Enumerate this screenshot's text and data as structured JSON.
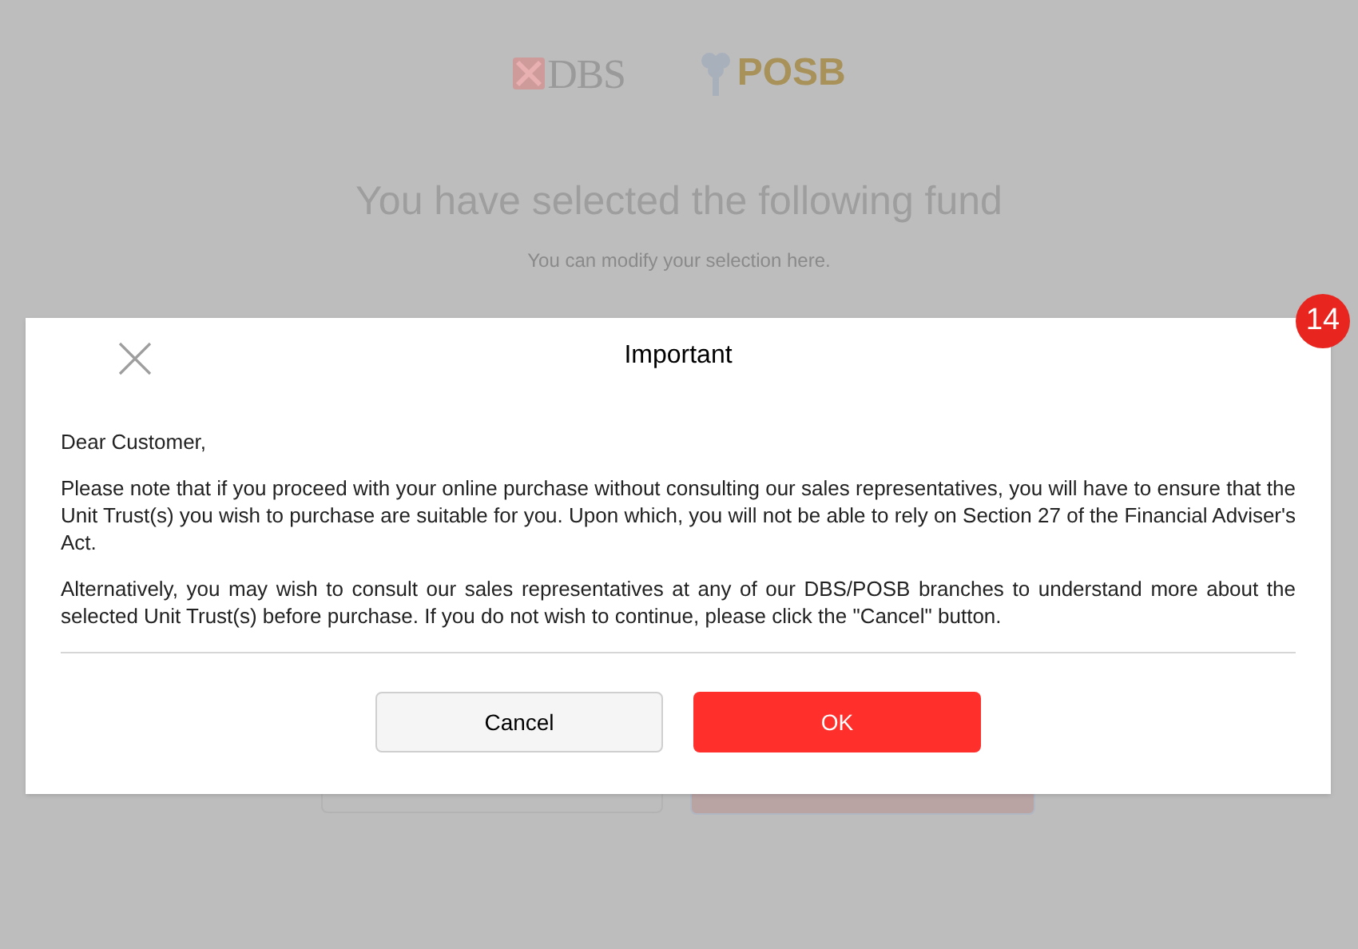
{
  "background": {
    "logos": [
      "DBS",
      "POSB"
    ],
    "heading": "You have selected the following fund",
    "subheading": "You can modify your selection here."
  },
  "dialog": {
    "title": "Important",
    "greeting": "Dear Customer,",
    "paragraphs": [
      "Please note that if you proceed with your online purchase without consulting our sales representatives, you will have to ensure that the Unit Trust(s) you wish to purchase are suitable for you. Upon which, you will not be able to rely on Section 27 of the Financial Adviser's Act.",
      "Alternatively, you may wish to consult our sales representatives at any of our DBS/POSB branches to understand more about the selected Unit Trust(s) before purchase. If you do not wish to continue, please click the \"Cancel\" button."
    ],
    "buttons": [
      {
        "label": "Cancel",
        "kind": "secondary"
      },
      {
        "label": "OK",
        "kind": "primary"
      }
    ]
  },
  "step_badge": "14"
}
